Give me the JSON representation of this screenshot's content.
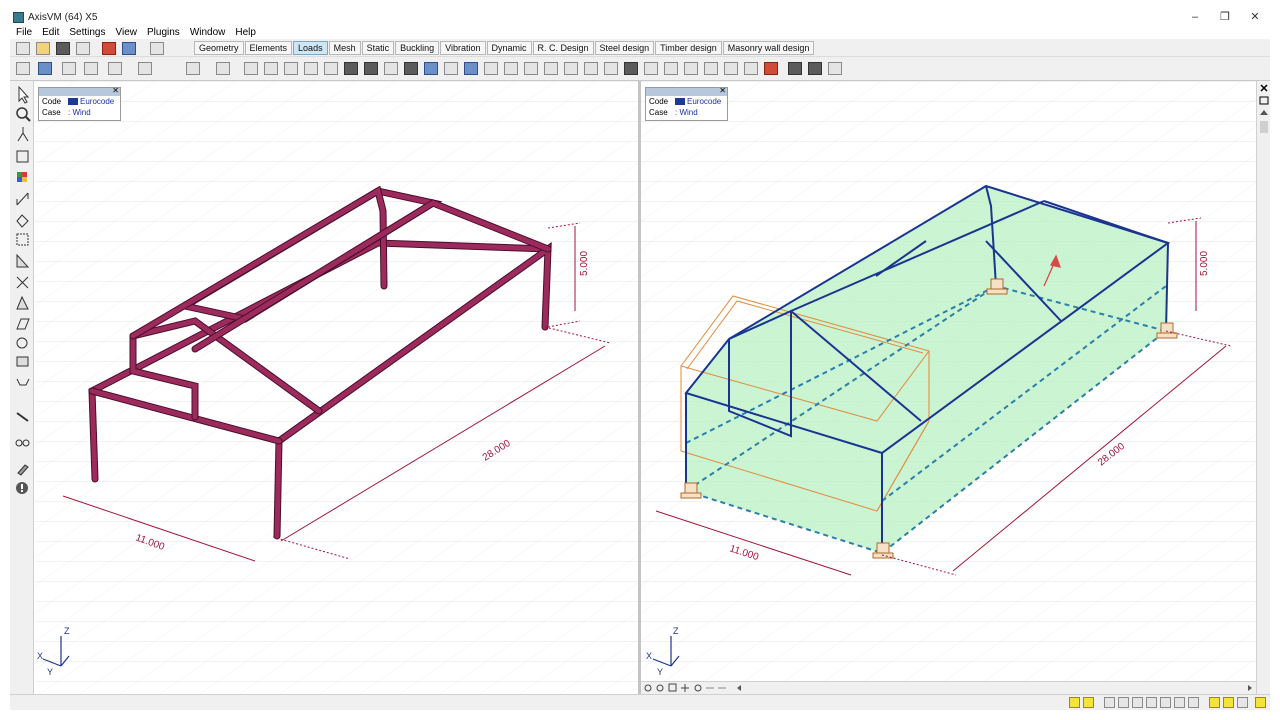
{
  "window": {
    "title": "AxisVM (64) X5",
    "controls": {
      "minimize": "–",
      "maximize": "❐",
      "close": "✕"
    }
  },
  "menu": [
    "File",
    "Edit",
    "Settings",
    "View",
    "Plugins",
    "Window",
    "Help"
  ],
  "tabs": [
    {
      "label": "Geometry",
      "active": false
    },
    {
      "label": "Elements",
      "active": false
    },
    {
      "label": "Loads",
      "active": true
    },
    {
      "label": "Mesh",
      "active": false
    },
    {
      "label": "Static",
      "active": false
    },
    {
      "label": "Buckling",
      "active": false
    },
    {
      "label": "Vibration",
      "active": false
    },
    {
      "label": "Dynamic",
      "active": false
    },
    {
      "label": "R. C. Design",
      "active": false
    },
    {
      "label": "Steel design",
      "active": false
    },
    {
      "label": "Timber design",
      "active": false
    },
    {
      "label": "Masonry wall design",
      "active": false
    }
  ],
  "left_view": {
    "info": {
      "code_key": "Code",
      "code_value": "Eurocode",
      "case_key": "Case",
      "case_value": ": Wind",
      "close": "✕"
    },
    "dimensions": {
      "width": "11.000",
      "length": "28.000",
      "height": "5.000"
    },
    "axes": {
      "x": "X",
      "y": "Y",
      "z": "Z"
    }
  },
  "right_view": {
    "info": {
      "code_key": "Code",
      "code_value": "Eurocode",
      "case_key": "Case",
      "case_value": ": Wind",
      "close": "✕"
    },
    "dimensions": {
      "width": "11.000",
      "length": "28.000",
      "height": "5.000"
    },
    "axes": {
      "x": "X",
      "y": "Y",
      "z": "Z"
    }
  },
  "colors": {
    "frame": "#9c2a5c",
    "frame_edge": "#4a0f2a",
    "dimension": "#a3163a",
    "grid": "#d6d6d6",
    "load_panel": "#b3f0bf",
    "member_blue": "#1a3590",
    "dashed_teal": "#2c7fa8",
    "wind_box": "#e38a3c"
  }
}
